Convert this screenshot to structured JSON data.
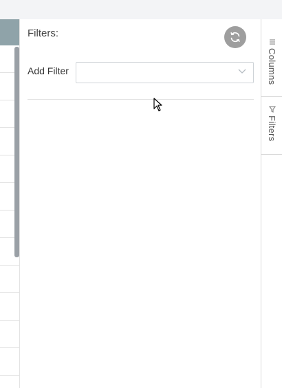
{
  "panel": {
    "title": "Filters:",
    "add_filter_label": "Add Filter",
    "select_value": ""
  },
  "sidebar": {
    "tabs": [
      {
        "label": "Columns",
        "icon": "columns-icon"
      },
      {
        "label": "Filters",
        "icon": "filter-icon"
      }
    ]
  },
  "colors": {
    "grid_header": "#8fa3a9",
    "refresh_button": "#9e9e9e",
    "border": "#d9d9d9"
  }
}
